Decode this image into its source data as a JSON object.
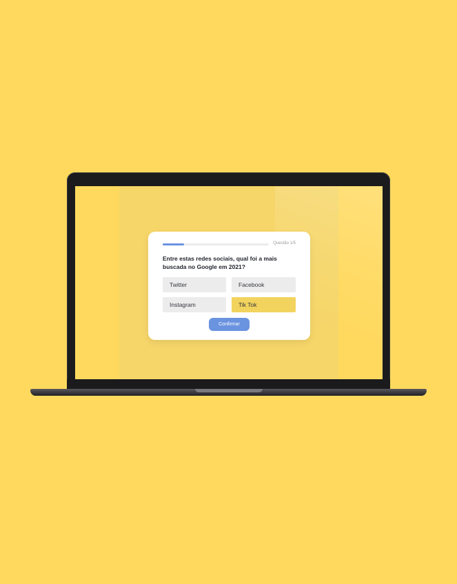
{
  "quiz": {
    "progress_fraction": 0.2,
    "counter_label": "Questão 1/5",
    "question": "Entre estas redes sociais, qual foi a mais buscada no Google em 2021?",
    "options": [
      {
        "label": "Twitter",
        "selected": false
      },
      {
        "label": "Facebook",
        "selected": false
      },
      {
        "label": "Instagram",
        "selected": false
      },
      {
        "label": "Tik Tok",
        "selected": true
      }
    ],
    "confirm_label": "Confirmar"
  },
  "colors": {
    "background": "#FFD95E",
    "accent": "#6A93E0",
    "selected_option": "#F2D35E",
    "option": "#ECECEC"
  }
}
